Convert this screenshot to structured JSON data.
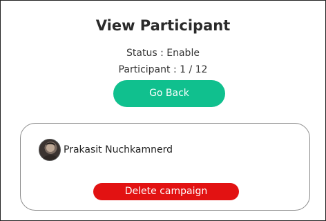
{
  "header": {
    "title": "View Participant"
  },
  "info": {
    "status_text": "Status : Enable",
    "participant_text": "Participant : 1 / 12"
  },
  "actions": {
    "go_back_label": "Go Back"
  },
  "participant_card": {
    "avatar_icon": "user-photo-avatar",
    "name": "Prakasit Nuchkamnerd",
    "delete_label": "Delete campaign"
  },
  "colors": {
    "primary": "#10c08e",
    "danger": "#e21212",
    "border": "#8c8c8c"
  }
}
